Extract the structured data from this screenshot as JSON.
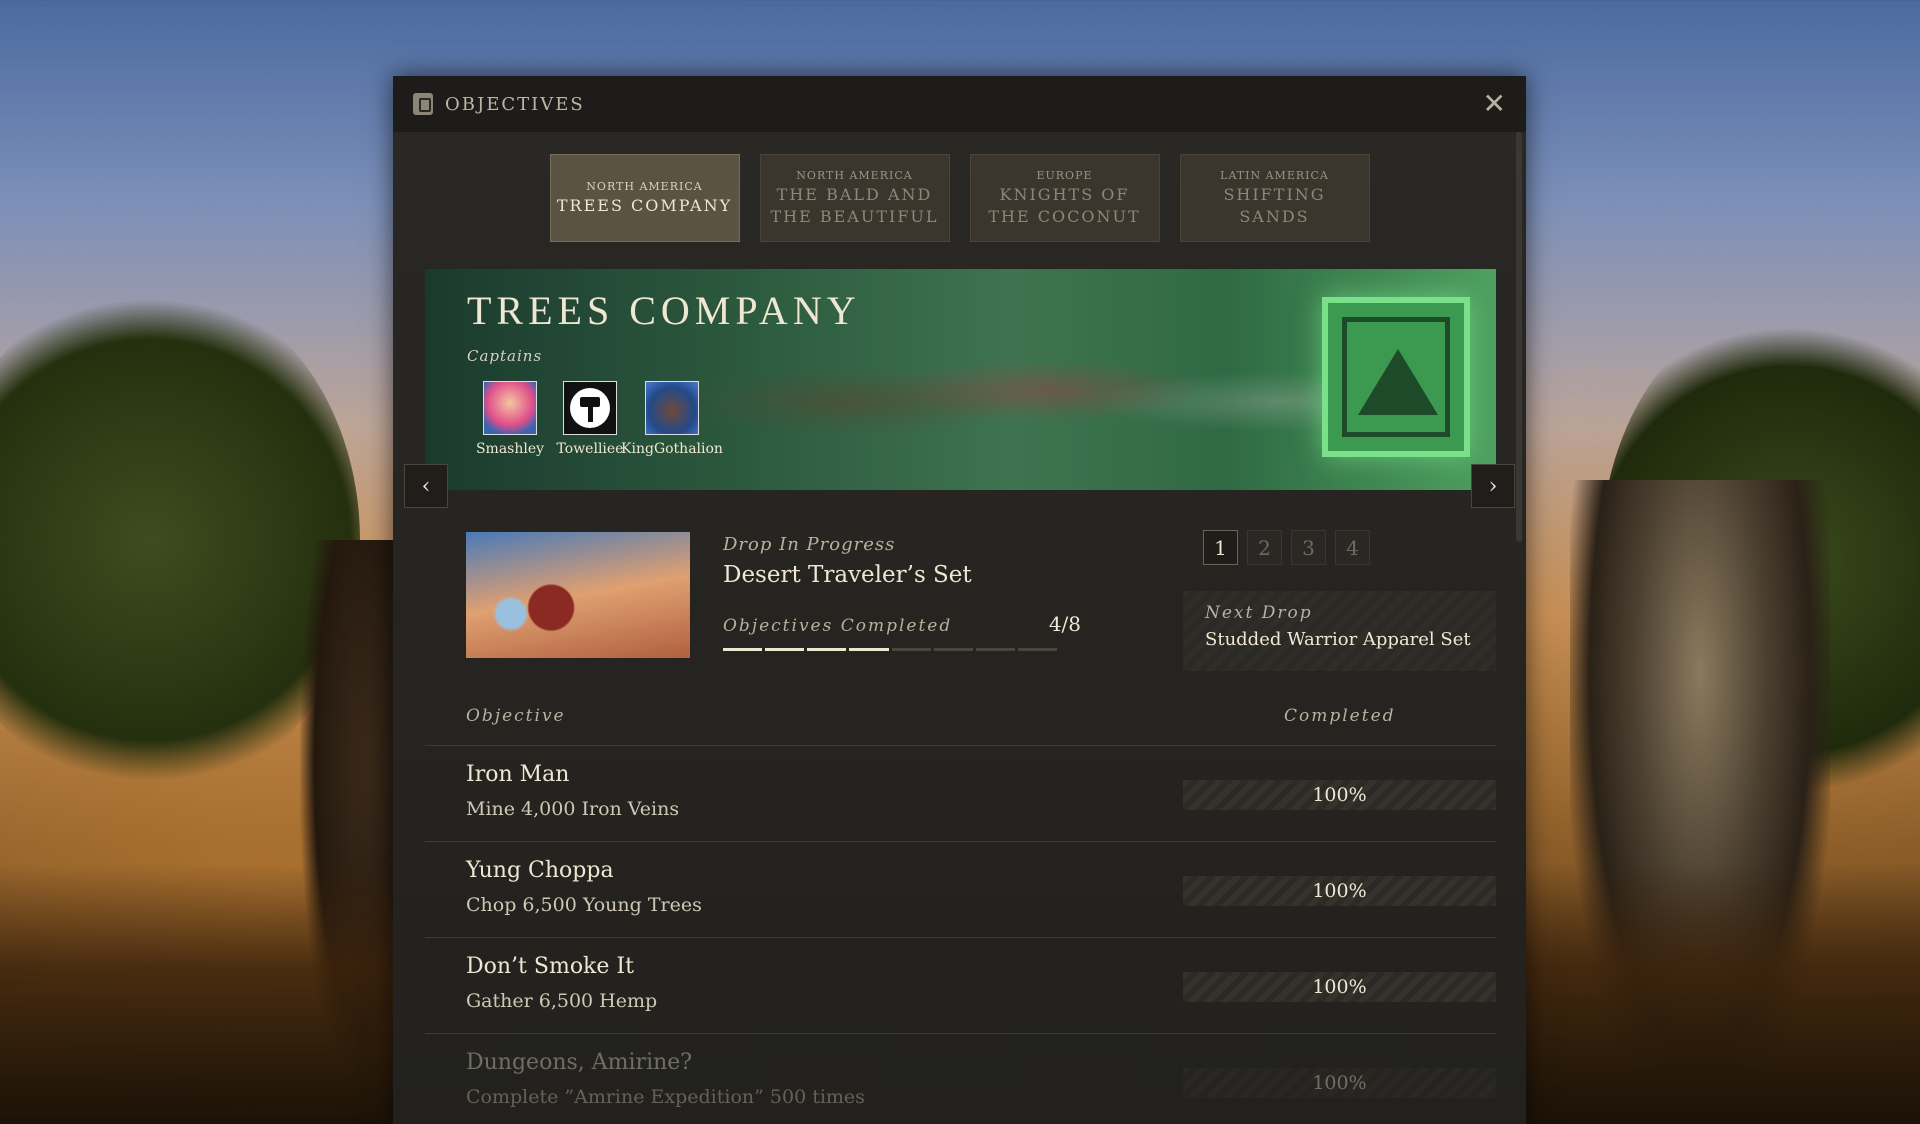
{
  "window": {
    "title": "OBJECTIVES",
    "close_symbol": "✕"
  },
  "tabs": [
    {
      "region": "NORTH AMERICA",
      "name": "TREES COMPANY",
      "active": true
    },
    {
      "region": "NORTH AMERICA",
      "name": "THE BALD AND\nTHE BEAUTIFUL",
      "active": false
    },
    {
      "region": "EUROPE",
      "name": "KNIGHTS OF\nTHE COCONUT",
      "active": false
    },
    {
      "region": "LATIN AMERICA",
      "name": "SHIFTING\nSANDS",
      "active": false
    }
  ],
  "banner": {
    "title": "TREES COMPANY",
    "captains_label": "Captains",
    "captains": [
      {
        "name": "Smashley"
      },
      {
        "name": "Towelliee"
      },
      {
        "name": "KingGothalion"
      }
    ]
  },
  "nav": {
    "prev_symbol": "‹",
    "next_symbol": "›"
  },
  "drop": {
    "status": "Drop In Progress",
    "name": "Desert Traveler’s Set",
    "objectives_label": "Objectives Completed",
    "objectives_count": "4/8",
    "completed": 4,
    "total": 8
  },
  "pages": [
    "1",
    "2",
    "3",
    "4"
  ],
  "active_page": "1",
  "next_drop": {
    "label": "Next Drop",
    "name": "Studded Warrior Apparel Set"
  },
  "table": {
    "col_objective": "Objective",
    "col_completed": "Completed",
    "rows": [
      {
        "name": "Iron Man",
        "desc": "Mine 4,000 Iron Veins",
        "completed": "100%"
      },
      {
        "name": "Yung Choppa",
        "desc": "Chop 6,500 Young Trees",
        "completed": "100%"
      },
      {
        "name": "Don’t Smoke It",
        "desc": "Gather 6,500 Hemp",
        "completed": "100%"
      },
      {
        "name": "Dungeons, Amirine?",
        "desc": "Complete ”Amrine Expedition” 500 times",
        "completed": "100%"
      }
    ]
  }
}
